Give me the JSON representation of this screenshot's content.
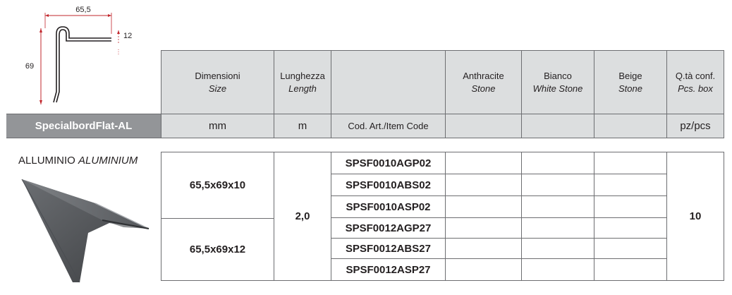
{
  "drawing": {
    "dim_width": "65,5",
    "dim_height": "69",
    "dim_lip": "12"
  },
  "header": {
    "size": {
      "it": "Dimensioni",
      "en": "Size"
    },
    "length": {
      "it": "Lunghezza",
      "en": "Length"
    },
    "anthracite": {
      "it": "Anthracite",
      "en": "Stone"
    },
    "white": {
      "it": "Bianco",
      "en": "White Stone"
    },
    "beige": {
      "it": "Beige",
      "en": "Stone"
    },
    "qty": {
      "it": "Q.tà conf.",
      "en": "Pcs. box"
    }
  },
  "product_name": "SpecialbordFlat-AL",
  "units": {
    "size": "mm",
    "length": "m",
    "code": "Cod. Art./Item Code",
    "qty": "pz/pcs"
  },
  "material": {
    "it": "ALLUMINIO",
    "en": "ALUMINIUM"
  },
  "rows": {
    "size_a": "65,5x69x10",
    "size_b": "65,5x69x12",
    "length": "2,0",
    "qty": "10",
    "codes": [
      "SPSF0010AGP02",
      "SPSF0010ABS02",
      "SPSF0010ASP02",
      "SPSF0012AGP27",
      "SPSF0012ABS27",
      "SPSF0012ASP27"
    ]
  }
}
